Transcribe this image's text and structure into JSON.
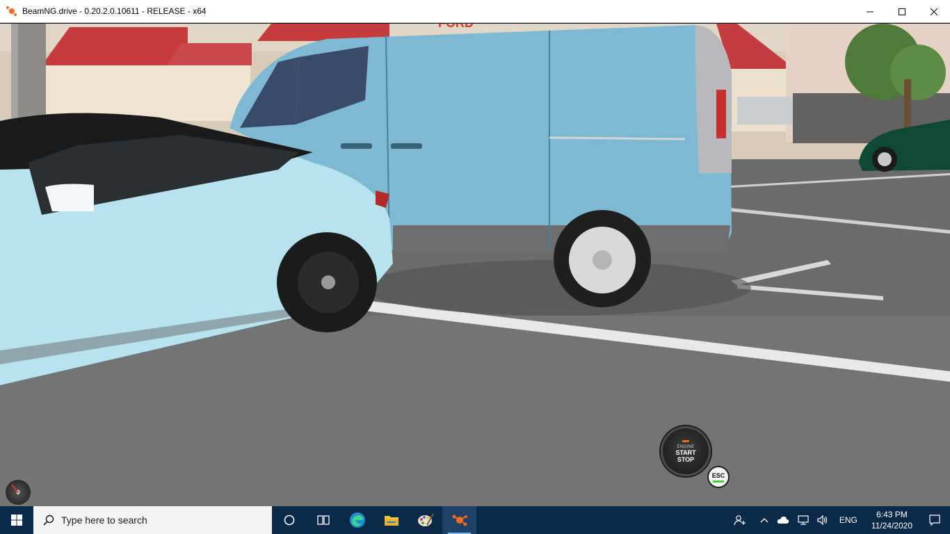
{
  "window": {
    "title": "BeamNG.drive - 0.20.2.0.10611 - RELEASE - x64",
    "app_icon": "beamng-logo-icon",
    "minimize_icon": "minimize-icon",
    "maximize_icon": "maximize-icon",
    "close_icon": "close-icon"
  },
  "scene": {
    "storefront_sign": "FORD"
  },
  "hud": {
    "engine_button": {
      "label": "ENGINE",
      "start": "START",
      "stop": "STOP",
      "indicator_color": "#ff6a1a"
    },
    "esc_button": {
      "label": "ESC",
      "indicator_color": "#3fd13f"
    },
    "gauge": {
      "value": "0"
    }
  },
  "taskbar": {
    "start_icon": "windows-start-icon",
    "search": {
      "placeholder": "Type here to search",
      "icon": "search-icon"
    },
    "pinned": [
      {
        "name": "cortana-icon"
      },
      {
        "name": "task-view-icon"
      },
      {
        "name": "edge-icon"
      },
      {
        "name": "file-explorer-icon"
      },
      {
        "name": "paint-icon"
      },
      {
        "name": "beamng-icon",
        "active": true
      }
    ],
    "tray": {
      "language": "ENG",
      "time": "6:43 PM",
      "date": "11/24/2020"
    },
    "colors": {
      "background": "#0b2a4a",
      "accent": "#7ab7ff"
    }
  }
}
